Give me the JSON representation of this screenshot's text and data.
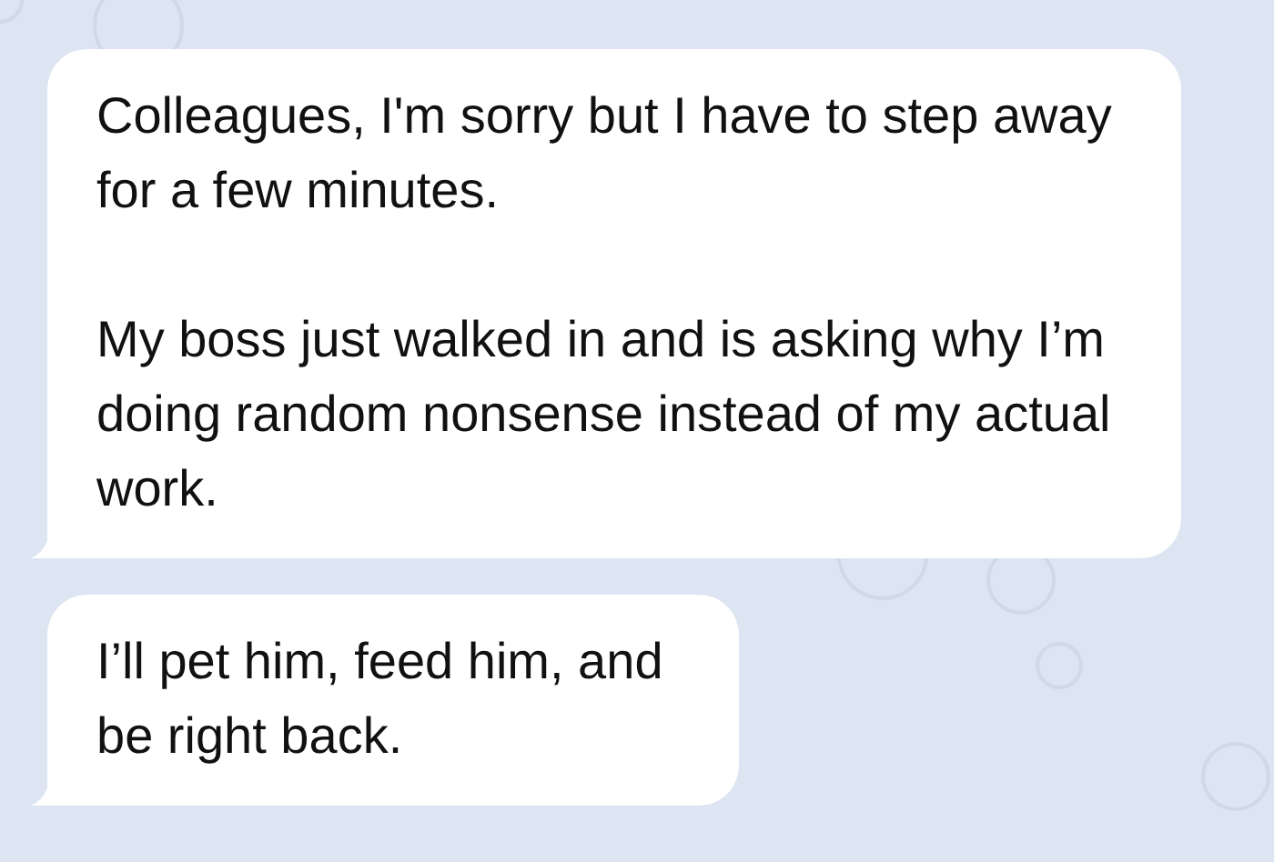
{
  "messages": [
    {
      "paragraphs": [
        "Colleagues, I'm sorry but I have to step away for a few minutes.",
        "My boss just walked in and is asking why I’m doing random nonsense instead of my actual work."
      ]
    },
    {
      "paragraphs": [
        "I’ll pet him, feed him, and be right back."
      ]
    }
  ]
}
